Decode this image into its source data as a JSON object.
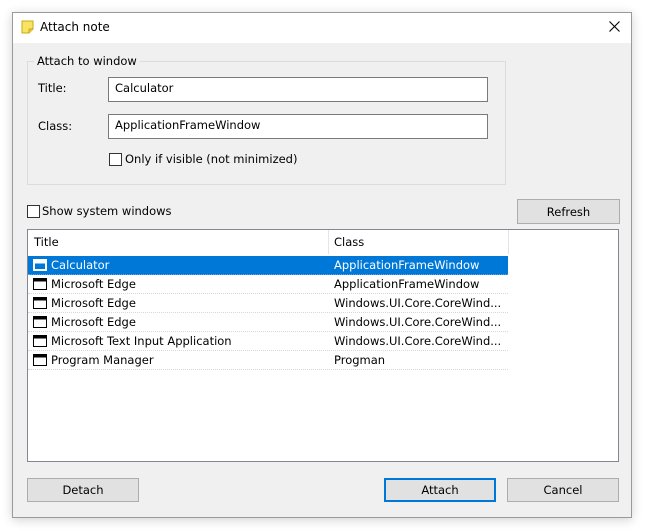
{
  "dialog": {
    "title": "Attach note",
    "icon": "sticky-note-icon"
  },
  "attach_group": {
    "legend": "Attach to window",
    "title_label": "Title:",
    "title_value": "Calculator",
    "class_label": "Class:",
    "class_value": "ApplicationFrameWindow",
    "only_visible_label": "Only if visible (not minimized)",
    "only_visible_checked": false
  },
  "show_system": {
    "label": "Show system windows",
    "checked": false
  },
  "refresh_label": "Refresh",
  "list": {
    "columns": [
      "Title",
      "Class"
    ],
    "rows": [
      {
        "title": "Calculator",
        "class": "ApplicationFrameWindow",
        "selected": true
      },
      {
        "title": "Microsoft Edge",
        "class": "ApplicationFrameWindow",
        "selected": false
      },
      {
        "title": "Microsoft Edge",
        "class": "Windows.UI.Core.CoreWind...",
        "selected": false
      },
      {
        "title": "Microsoft Edge",
        "class": "Windows.UI.Core.CoreWind...",
        "selected": false
      },
      {
        "title": "Microsoft Text Input Application",
        "class": "Windows.UI.Core.CoreWind...",
        "selected": false
      },
      {
        "title": "Program Manager",
        "class": "Progman",
        "selected": false
      }
    ]
  },
  "buttons": {
    "detach": "Detach",
    "attach": "Attach",
    "cancel": "Cancel"
  },
  "colors": {
    "selection": "#0078d7",
    "dialog_bg": "#f0f0f0",
    "note_yellow": "#f7e463"
  }
}
